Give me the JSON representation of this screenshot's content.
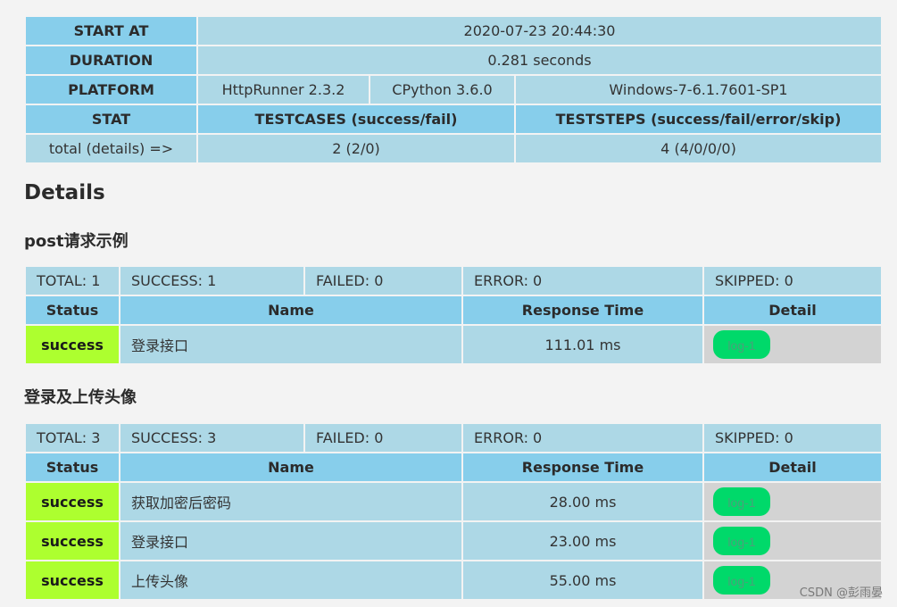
{
  "summary": {
    "start_label": "START AT",
    "start_value": "2020-07-23 20:44:30",
    "duration_label": "DURATION",
    "duration_value": "0.281 seconds",
    "platform_label": "PLATFORM",
    "platform_httprunner": "HttpRunner 2.3.2",
    "platform_python": "CPython 3.6.0",
    "platform_os": "Windows-7-6.1.7601-SP1",
    "stat_label": "STAT",
    "testcases_label": "TESTCASES (success/fail)",
    "teststeps_label": "TESTSTEPS (success/fail/error/skip)",
    "total_label": "total (details) =>",
    "testcases_value": "2 (2/0)",
    "teststeps_value": "4 (4/0/0/0)"
  },
  "details_heading": "Details",
  "columns": {
    "status": "Status",
    "name": "Name",
    "response_time": "Response Time",
    "detail": "Detail"
  },
  "suites": [
    {
      "title": "post请求示例",
      "total": "TOTAL: 1",
      "success": "SUCCESS: 1",
      "failed": "FAILED: 0",
      "error": "ERROR: 0",
      "skipped": "SKIPPED: 0",
      "steps": [
        {
          "status": "success",
          "name": "登录接口",
          "time": "111.01 ms",
          "log": "log-1"
        }
      ]
    },
    {
      "title": "登录及上传头像",
      "total": "TOTAL: 3",
      "success": "SUCCESS: 3",
      "failed": "FAILED: 0",
      "error": "ERROR: 0",
      "skipped": "SKIPPED: 0",
      "steps": [
        {
          "status": "success",
          "name": "获取加密后密码",
          "time": "28.00 ms",
          "log": "log-1"
        },
        {
          "status": "success",
          "name": "登录接口",
          "time": "23.00 ms",
          "log": "log-1"
        },
        {
          "status": "success",
          "name": "上传头像",
          "time": "55.00 ms",
          "log": "log-1"
        }
      ]
    }
  ],
  "watermark": "CSDN @彭雨晏",
  "colors": {
    "header_bg": "#87ceeb",
    "cell_bg": "#add8e6",
    "success_bg": "#adff2f",
    "detail_bg": "#d3d3d3",
    "log_button": "#00d96a"
  }
}
